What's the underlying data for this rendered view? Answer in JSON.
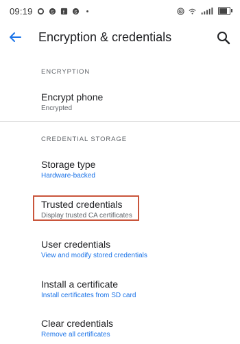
{
  "status_bar": {
    "time": "09:19",
    "icons_left": [
      "whatsapp-icon",
      "skype-icon",
      "facebook-icon",
      "skype-icon",
      "dot-icon"
    ],
    "icons_right": [
      "hotspot-icon",
      "wifi-icon",
      "signal-icon",
      "battery-icon"
    ]
  },
  "app_bar": {
    "title": "Encryption & credentials"
  },
  "sections": {
    "encryption_header": "ENCRYPTION",
    "credential_header": "CREDENTIAL STORAGE"
  },
  "items": {
    "encrypt_phone": {
      "title": "Encrypt phone",
      "subtitle": "Encrypted"
    },
    "storage_type": {
      "title": "Storage type",
      "subtitle": "Hardware-backed"
    },
    "trusted_credentials": {
      "title": "Trusted credentials",
      "subtitle": "Display trusted CA certificates"
    },
    "user_credentials": {
      "title": "User credentials",
      "subtitle": "View and modify stored credentials"
    },
    "install_certificate": {
      "title": "Install a certificate",
      "subtitle": "Install certificates from SD card"
    },
    "clear_credentials": {
      "title": "Clear credentials",
      "subtitle": "Remove all certificates"
    }
  },
  "colors": {
    "accent": "#1a73e8",
    "highlight_border": "#c9553b"
  }
}
